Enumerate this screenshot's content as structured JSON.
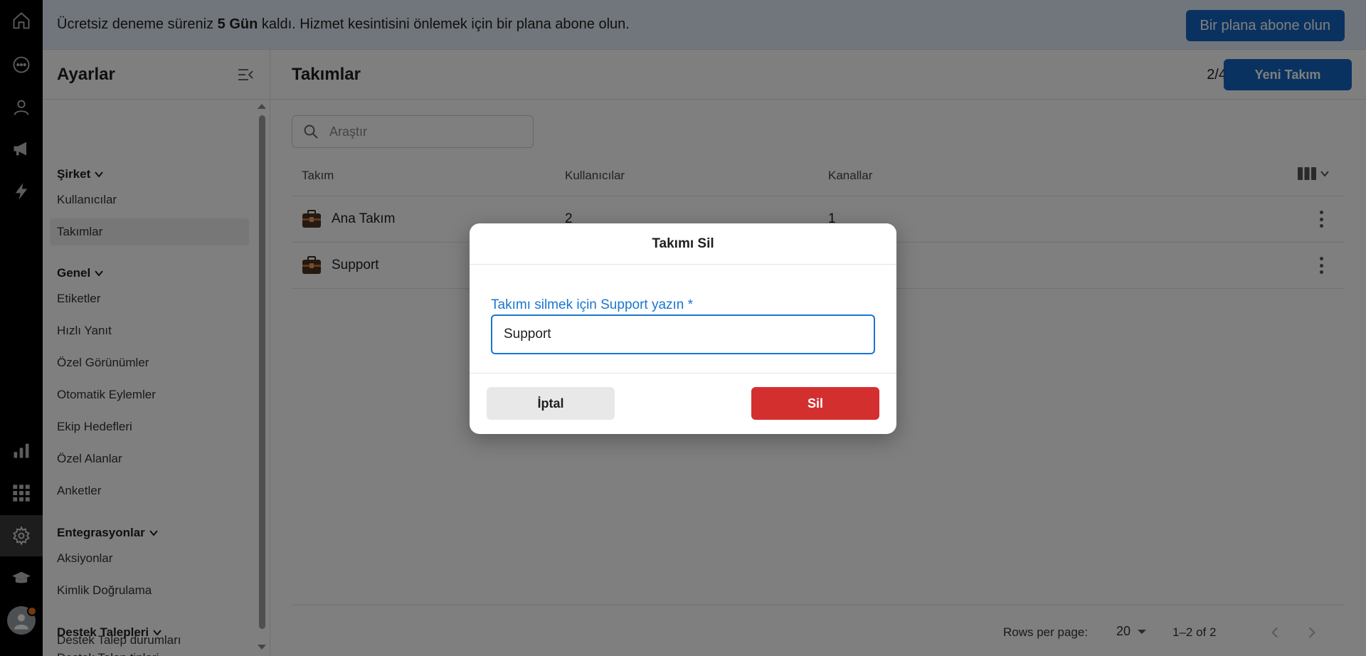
{
  "banner": {
    "text_before": "Ücretsiz deneme süreniz ",
    "text_bold": "5 Gün",
    "text_after": " kaldı. Hizmet kesintisini önlemek için bir plana abone olun.",
    "button": "Bir plana abone olun"
  },
  "sidebar": {
    "title": "Ayarlar",
    "sections": [
      {
        "label": "Şirket",
        "items": [
          "Kullanıcılar",
          "Takımlar"
        ]
      },
      {
        "label": "Genel",
        "items": [
          "Etiketler",
          "Hızlı Yanıt",
          "Özel Görünümler",
          "Otomatik Eylemler",
          "Ekip Hedefleri",
          "Özel Alanlar",
          "Anketler"
        ]
      },
      {
        "label": "Entegrasyonlar",
        "items": [
          "Aksiyonlar",
          "Kimlik Doğrulama"
        ]
      },
      {
        "label": "Destek Talepleri",
        "items": [
          "Destek Talep tipleri",
          "Destek Talep durumları"
        ]
      }
    ],
    "active_item": "Takımlar"
  },
  "main": {
    "title": "Takımlar",
    "count": "2/4",
    "new_button": "Yeni Takım",
    "search_placeholder": "Araştır",
    "columns": [
      "Takım",
      "Kullanıcılar",
      "Kanallar"
    ],
    "rows": [
      {
        "name": "Ana Takım",
        "users": "2",
        "channels": "1"
      },
      {
        "name": "Support",
        "users": "",
        "channels": ""
      }
    ],
    "footer": {
      "rows_per_page_label": "Rows per page:",
      "rows_per_page": "20",
      "range": "1–2 of 2"
    }
  },
  "dialog": {
    "title": "Takımı Sil",
    "label": "Takımı silmek için Support yazın *",
    "input_value": "Support",
    "cancel": "İptal",
    "delete": "Sil"
  },
  "colors": {
    "primary": "#1565c0",
    "danger": "#d32f2f",
    "banner_bg": "#e3ecf8"
  }
}
